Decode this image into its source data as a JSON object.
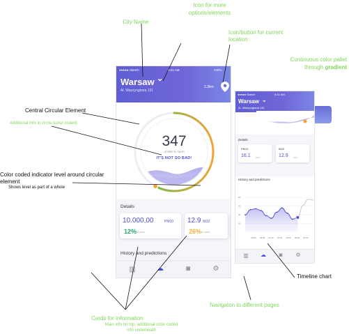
{
  "annotations": {
    "icon_more": "Icon for more options/elements",
    "city_name": "City Name",
    "icon_location": "Icon/button for current location",
    "continuous_color": "Continuous color pallet through",
    "gradient": "gradient",
    "central": "Central Circular Element",
    "additional_info": "Additional Info in circle (color coded)",
    "indicator_title": "Color coded indicator level around circular element",
    "indicator_sub": "Shows level as part of a whole",
    "timeline": "Timeline chart",
    "navigation": "Navigaton to different pages",
    "cards_title": "Cards for information",
    "cards_sub": "Main info on top, additional color coded info underneath"
  },
  "phone1": {
    "status_left": "●●●●● Sketch",
    "status_time": "9:41 AM",
    "status_right": "100%",
    "city": "Warsaw",
    "chevron": "⌄",
    "address": "Al. Waszyngtona 131",
    "distance": "2.3km",
    "reading": "347",
    "reading_norm": "of 600 % norm",
    "status_message": "IT'S NOT SO BAD!",
    "details_title": "Details",
    "card1": {
      "value": "10.000,00",
      "unit": "PM10",
      "pct": "12%",
      "sub": "of norm",
      "pct_color": "#22a96b"
    },
    "card2": {
      "value": "12.9",
      "unit": "NO2",
      "pct": "26%",
      "sub": "of norm",
      "pct_color": "#f2b03c"
    },
    "history_title": "History and predictions",
    "level_fraction": 0.58
  },
  "phone2": {
    "status_left": "●●●●● Sketch",
    "status_time": "9:41 AM",
    "city": "Warsaw",
    "chevron": "⌄",
    "address": "Al. Waszyngtona 131",
    "details_title": "Details",
    "card1": {
      "label": "PM10",
      "value": "16.1",
      "unit": "%",
      "sub": "10%"
    },
    "card2": {
      "label": "NO2",
      "value": "12.9",
      "unit": "%",
      "sub": "10%"
    },
    "history_title": "History and predictions"
  },
  "chart_data": {
    "type": "line",
    "title": "History and predictions",
    "yticks": [
      "80",
      "60",
      "40",
      "20"
    ],
    "xticks": [
      "19:00",
      "20:00",
      "21:00",
      "22:00",
      "23:00",
      "00:00",
      "01:00"
    ],
    "x": [
      0,
      1,
      2,
      3,
      4,
      5,
      6,
      7,
      8,
      9,
      10,
      11,
      12,
      13
    ],
    "values": [
      40,
      52,
      54,
      50,
      38,
      32,
      46,
      56,
      44,
      30,
      34,
      62,
      76,
      74
    ],
    "highlight_index": 10,
    "ylim": [
      0,
      90
    ]
  },
  "colors": {
    "accent": "#4b4fd0",
    "annotation": "#7ed957",
    "ring_green": "#54c04c",
    "ring_orange": "#f2a43a"
  },
  "icons": {
    "location": "location-pin-icon",
    "more": "chevron-down-icon"
  }
}
